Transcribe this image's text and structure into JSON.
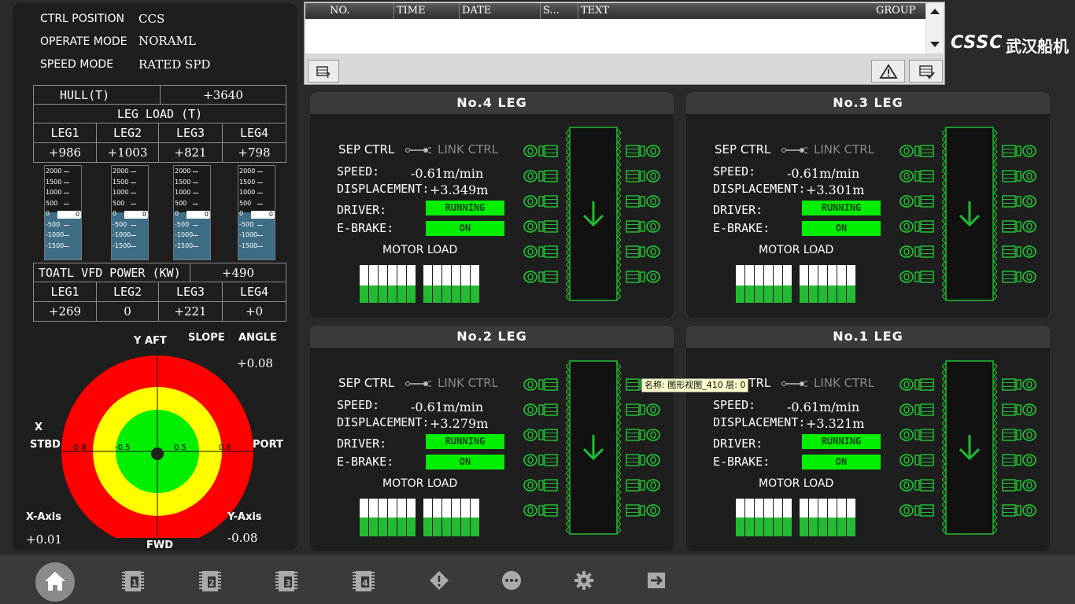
{
  "status": {
    "rows": [
      {
        "label": "CTRL POSITION",
        "value": "CCS"
      },
      {
        "label": "OPERATE MODE",
        "value": "NORAML"
      },
      {
        "label": "SPEED MODE",
        "value": "RATED SPD"
      }
    ]
  },
  "hull": {
    "label": "HULL(T)",
    "value": "+3640"
  },
  "leg_load": {
    "title": "LEG LOAD (T)",
    "headers": [
      "LEG1",
      "LEG2",
      "LEG3",
      "LEG4"
    ],
    "values": [
      "+986",
      "+1003",
      "+821",
      "+798"
    ]
  },
  "gauges": {
    "ticks": [
      "2000",
      "1500",
      "1000",
      "500",
      "0",
      "-500",
      "-1000",
      "-1500"
    ],
    "pointer": [
      "0",
      "0",
      "0",
      "0"
    ]
  },
  "vfd": {
    "title": "TOATL VFD POWER (KW)",
    "total": "+490",
    "headers": [
      "LEG1",
      "LEG2",
      "LEG3",
      "LEG4"
    ],
    "values": [
      "+269",
      "0",
      "+221",
      "+0"
    ]
  },
  "tilt": {
    "y_aft": "Y AFT",
    "slope": "SLOPE",
    "angle": "ANGLE",
    "angle_value": "+0.08",
    "x": "X",
    "stbd": "STBD",
    "port": "PORT",
    "fwd": "FWD",
    "x_axis": "X-Axis",
    "y_axis": "Y-Axis",
    "x_value": "+0.01",
    "y_value": "-0.08",
    "scale": [
      "-0.8",
      "-0.5",
      "0.5",
      "0.8"
    ],
    "colors": {
      "outer": "#ff0000",
      "middle": "#ffff00",
      "inner": "#00ee00"
    }
  },
  "alarm": {
    "columns": [
      "NO.",
      "TIME",
      "DATE",
      "S...",
      "TEXT",
      "GROUP"
    ]
  },
  "brand": {
    "logo": "CSSC",
    "name": "武汉船机"
  },
  "legs": [
    {
      "title": "No.4 LEG",
      "sep": "SEP CTRL",
      "link": "LINK CTRL",
      "speed_label": "SPEED:",
      "speed": "-0.61m/min",
      "disp_label": "DISPLACEMENT:",
      "disp": "+3.349m",
      "driver_label": "DRIVER:",
      "driver": "RUNNING",
      "brake_label": "E-BRAKE:",
      "brake": "ON",
      "motor_label": "MOTOR LOAD",
      "motor_load": [
        0.45,
        0.45,
        0.45,
        0.45,
        0.45,
        0.45,
        0.45,
        0.45,
        0.45,
        0.45,
        0.45,
        0.45
      ]
    },
    {
      "title": "No.3 LEG",
      "sep": "SEP CTRL",
      "link": "LINK CTRL",
      "speed_label": "SPEED:",
      "speed": "-0.61m/min",
      "disp_label": "DISPLACEMENT:",
      "disp": "+3.301m",
      "driver_label": "DRIVER:",
      "driver": "RUNNING",
      "brake_label": "E-BRAKE:",
      "brake": "ON",
      "motor_label": "MOTOR LOAD",
      "motor_load": [
        0.45,
        0.45,
        0.45,
        0.45,
        0.45,
        0.45,
        0.45,
        0.45,
        0.45,
        0.45,
        0.45,
        0.45
      ]
    },
    {
      "title": "No.2 LEG",
      "sep": "SEP CTRL",
      "link": "LINK CTRL",
      "speed_label": "SPEED:",
      "speed": "-0.61m/min",
      "disp_label": "DISPLACEMENT:",
      "disp": "+3.279m",
      "driver_label": "DRIVER:",
      "driver": "RUNNING",
      "brake_label": "E-BRAKE:",
      "brake": "ON",
      "motor_label": "MOTOR LOAD",
      "motor_load": [
        0.5,
        0.5,
        0.5,
        0.5,
        0.5,
        0.5,
        0.5,
        0.5,
        0.5,
        0.5,
        0.5,
        0.5
      ]
    },
    {
      "title": "No.1 LEG",
      "sep": "SEP CTRL",
      "link": "LINK CTRL",
      "speed_label": "SPEED:",
      "speed": "-0.61m/min",
      "disp_label": "DISPLACEMENT:",
      "disp": "+3.321m",
      "driver_label": "DRIVER:",
      "driver": "RUNNING",
      "brake_label": "E-BRAKE:",
      "brake": "ON",
      "motor_label": "MOTOR LOAD",
      "motor_load": [
        0.5,
        0.5,
        0.5,
        0.5,
        0.5,
        0.5,
        0.5,
        0.5,
        0.5,
        0.5,
        0.5,
        0.5
      ]
    }
  ],
  "tooltip": "名称: 图形视图_410  层: 0",
  "nav": [
    "home-icon",
    "leg1-icon",
    "leg2-icon",
    "leg3-icon",
    "leg4-icon",
    "alarm-icon",
    "more-icon",
    "settings-icon",
    "exit-icon"
  ],
  "colors": {
    "panel": "#1e1e1e",
    "accent_green": "#00ee00",
    "outline_green": "#22bb33"
  }
}
